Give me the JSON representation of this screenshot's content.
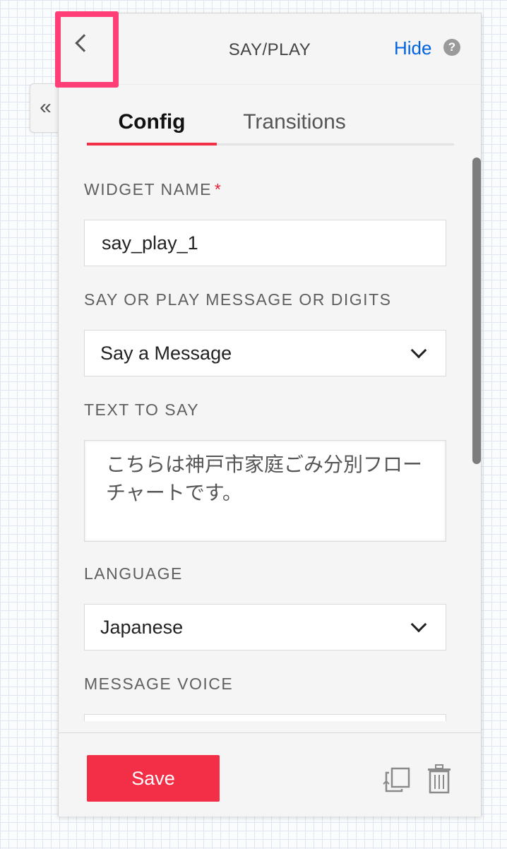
{
  "header": {
    "title": "SAY/PLAY",
    "hide_label": "Hide",
    "help_glyph": "?"
  },
  "collapse_tab": {
    "glyph": "«"
  },
  "tabs": [
    {
      "label": "Config",
      "active": true
    },
    {
      "label": "Transitions",
      "active": false
    }
  ],
  "form": {
    "widget_name": {
      "label": "WIDGET NAME",
      "required_mark": "*",
      "value": "say_play_1"
    },
    "say_or_play": {
      "label": "SAY OR PLAY MESSAGE OR DIGITS",
      "value": "Say a Message"
    },
    "text_to_say": {
      "label": "TEXT TO SAY",
      "value": "こちらは神戸市家庭ごみ分別フローチャートです。"
    },
    "language": {
      "label": "LANGUAGE",
      "value": "Japanese"
    },
    "message_voice": {
      "label": "MESSAGE VOICE"
    }
  },
  "footer": {
    "save_label": "Save"
  },
  "colors": {
    "accent": "#f22f46",
    "link": "#0263e0",
    "highlight": "#ff3d77"
  },
  "icons": [
    "chevron-left-icon",
    "double-chevron-left-icon",
    "help-icon",
    "chevron-down-icon",
    "duplicate-icon",
    "trash-icon"
  ]
}
